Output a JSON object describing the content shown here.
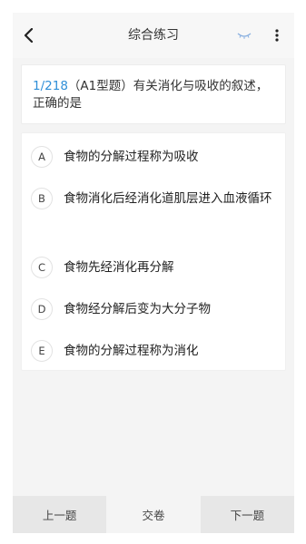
{
  "header": {
    "title": "综合练习",
    "icons": {
      "back": "chevron-left-icon",
      "eye": "eye-closed-icon",
      "more": "more-vertical-icon"
    },
    "eye_color": "#8ab0e0"
  },
  "question": {
    "index": "1/218",
    "text": "（A1型题）有关消化与吸收的叙述，正确的是"
  },
  "options": [
    {
      "letter": "A",
      "text": "食物的分解过程称为吸收"
    },
    {
      "letter": "B",
      "text": "食物消化后经消化道肌层进入血液循环"
    },
    {
      "letter": "C",
      "text": "食物先经消化再分解"
    },
    {
      "letter": "D",
      "text": "食物经分解后变为大分子物"
    },
    {
      "letter": "E",
      "text": "食物的分解过程称为消化"
    }
  ],
  "footer": {
    "prev_label": "上一题",
    "submit_label": "交卷",
    "next_label": "下一题"
  },
  "colors": {
    "accent": "#2f8fd8",
    "side_button": "#e7e7e7",
    "background": "#f4f4f4"
  }
}
